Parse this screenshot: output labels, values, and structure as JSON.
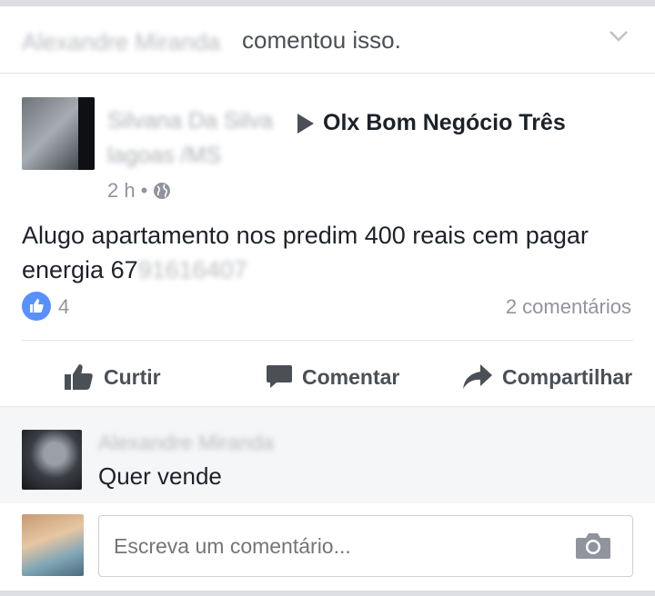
{
  "notice": {
    "actor_name": "Alexandre Miranda",
    "action_text": "comentou isso.",
    "menu_icon": "chevron-down-icon"
  },
  "post": {
    "author_name": "Silvana Da Silva",
    "arrow_icon": "triangle-right-icon",
    "group_name": "Olx Bom Negócio  Três",
    "group_name_cont": "lagoas /MS",
    "time": "2 h",
    "separator": "•",
    "privacy_icon": "globe-icon",
    "text": "Alugo apartamento nos predim 400 reais cem pagar energia 67",
    "phone_hidden": "91616407",
    "like_count": "4",
    "comments_count": "2 comentários"
  },
  "actions": {
    "like_label": "Curtir",
    "comment_label": "Comentar",
    "share_label": "Compartilhar"
  },
  "comment": {
    "author_name": "Alexandre Miranda",
    "text": "Quer vende"
  },
  "composer": {
    "placeholder": "Escreva um comentário...",
    "camera_icon": "camera-icon"
  },
  "colors": {
    "like_blue": "#5890ff",
    "text_dark": "#1d2129",
    "text_gray": "#90949c",
    "action_gray": "#4b4f56"
  }
}
